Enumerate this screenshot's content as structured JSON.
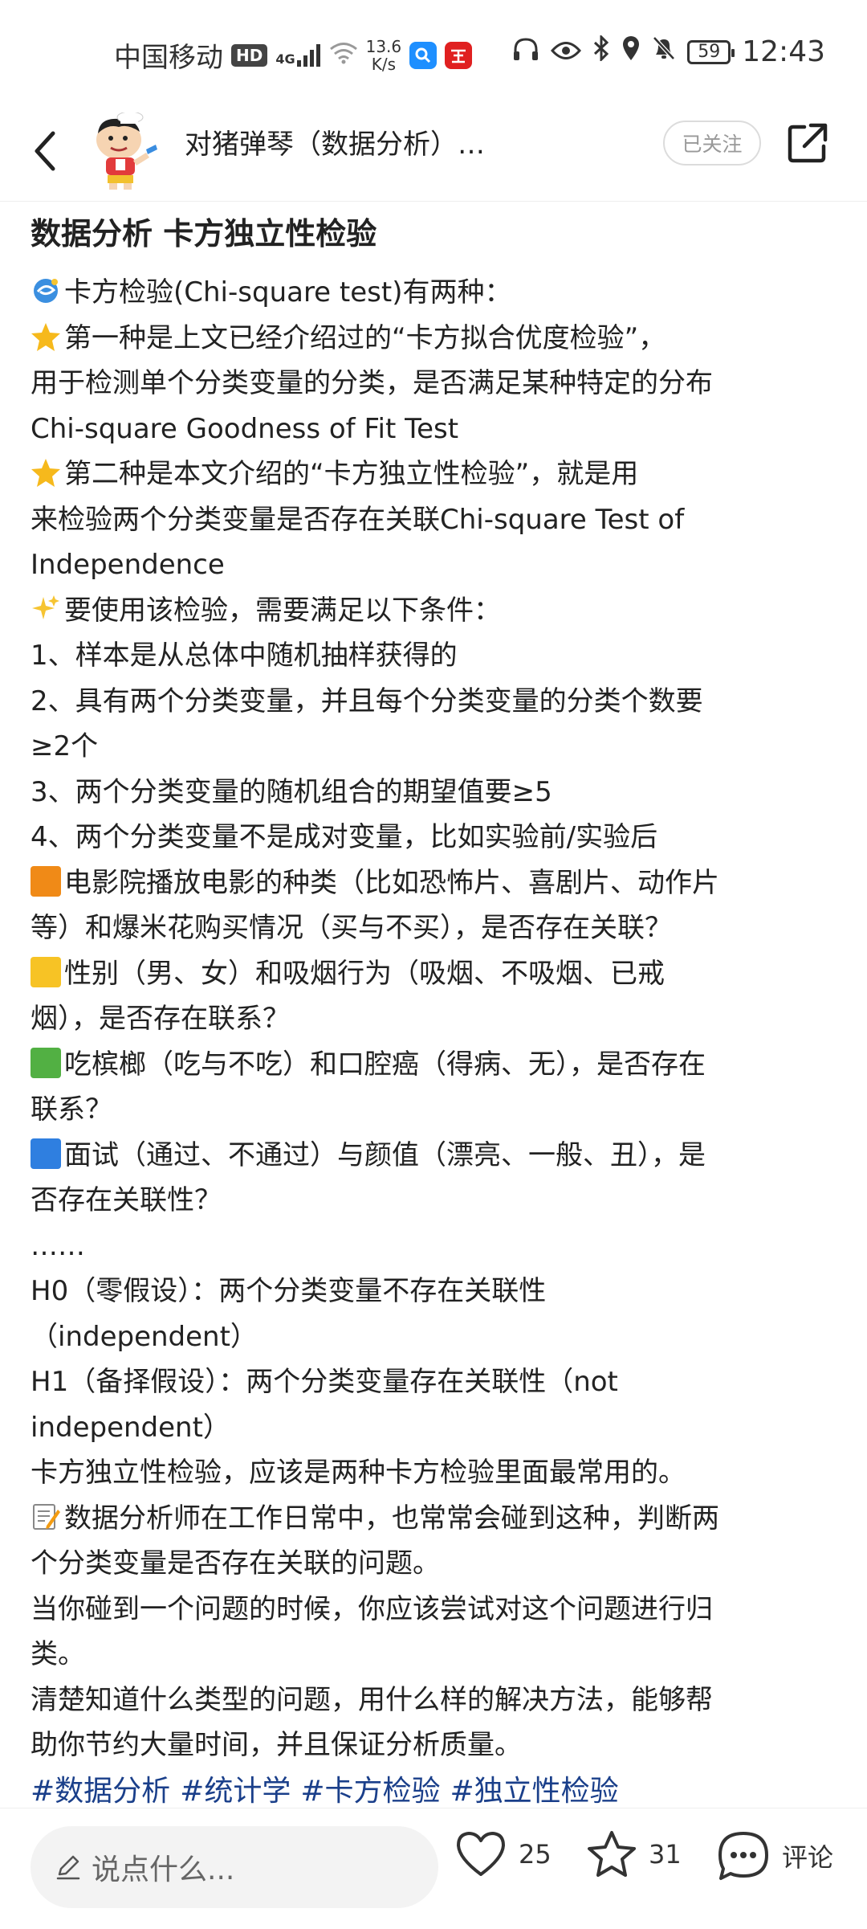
{
  "status_bar": {
    "carrier": "中国移动",
    "hd": "HD",
    "network": "4G",
    "speed_value": "13.6",
    "speed_unit": "K/s",
    "battery": "59",
    "time": "12:43"
  },
  "header": {
    "author_name": "对猪弹琴（数据分析）…",
    "follow_label": "已关注"
  },
  "post": {
    "title": "数据分析 卡方独立性检验",
    "lines": [
      "卡方检验(Chi-square test)有两种：",
      "第一种是上文已经介绍过的“卡方拟合优度检验”，",
      "用于检测单个分类变量的分类，是否满足某种特定的分布",
      "Chi-square Goodness of Fit Test",
      "第二种是本文介绍的“卡方独立性检验”，就是用",
      "来检验两个分类变量是否存在关联Chi-square Test of",
      "Independence",
      "要使用该检验，需要满足以下条件：",
      "1、样本是从总体中随机抽样获得的",
      "2、具有两个分类变量，并且每个分类变量的分类个数要",
      "≥2个",
      "3、两个分类变量的随机组合的期望值要≥5",
      "4、两个分类变量不是成对变量，比如实验前/实验后",
      "电影院播放电影的种类（比如恐怖片、喜剧片、动作片",
      "等）和爆米花购买情况（买与不买），是否存在关联？",
      "性别（男、女）和吸烟行为（吸烟、不吸烟、已戒",
      "烟），是否存在联系？",
      "吃槟榔（吃与不吃）和口腔癌（得病、无），是否存在",
      "联系？",
      "面试（通过、不通过）与颜值（漂亮、一般、丑），是",
      "否存在关联性？",
      "……",
      "H0（零假设）：两个分类变量不存在关联性",
      "（independent）",
      "H1（备择假设）：两个分类变量存在关联性（not",
      "independent）",
      "卡方独立性检验，应该是两种卡方检验里面最常用的。",
      "数据分析师在工作日常中，也常常会碰到这种，判断两",
      "个分类变量是否存在关联的问题。",
      "当你碰到一个问题的时候，你应该尝试对这个问题进行归",
      "类。",
      "清楚知道什么类型的问题，用什么样的解决方法，能够帮",
      "助你节约大量时间，并且保证分析质量。"
    ],
    "tags": [
      "#数据分析",
      "#统计学",
      "#卡方检验",
      "#独立性检验"
    ]
  },
  "bottom_bar": {
    "comment_placeholder": "说点什么...",
    "likes": "25",
    "stars": "31",
    "comment_label": "评论"
  },
  "colors": {
    "orange": "#f08a17",
    "yellow": "#f7c325",
    "green": "#52b043",
    "blue": "#2f7fe0",
    "tag": "#1a3f8a"
  }
}
